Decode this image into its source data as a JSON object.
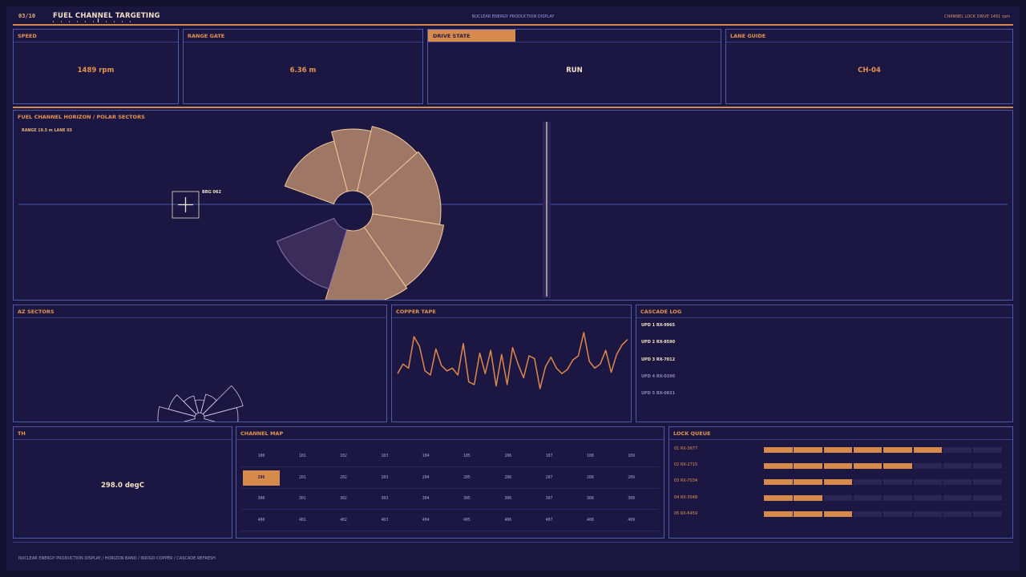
{
  "header": {
    "screen_index": "03/10",
    "title": "FUEL CHANNEL TARGETING",
    "system": "NUCLEAR ENERGY PRODUCTION DISPLAY",
    "status": "CHANNEL LOCK  DRIVE 1491 rpm"
  },
  "metrics": {
    "speed": {
      "label": "SPEED",
      "value": "1489 rpm"
    },
    "range_gate": {
      "label": "RANGE GATE",
      "value": "6.36 m"
    },
    "drive_state": {
      "label": "DRIVE STATE",
      "value": "RUN"
    },
    "lane_guide": {
      "label": "LANE GUIDE",
      "value": "CH-04"
    }
  },
  "horizon": {
    "title": "FUEL CHANNEL HORIZON  /  POLAR SECTORS",
    "subtitle": "RANGE 19.5 m  LANE 03",
    "bearing": "BRG 062"
  },
  "az_sectors": {
    "title": "AZ SECTORS"
  },
  "copper_tape": {
    "title": "COPPER TAPE",
    "values": [
      48,
      55,
      52,
      75,
      68,
      50,
      47,
      66,
      54,
      50,
      52,
      47,
      70,
      42,
      40,
      63,
      48,
      65,
      39,
      62,
      40,
      67,
      55,
      45,
      61,
      59,
      37,
      53,
      60,
      52,
      48,
      51,
      58,
      61,
      78,
      57,
      52,
      55,
      65,
      49,
      62,
      69,
      73
    ]
  },
  "cascade_log": {
    "title": "CASCADE LOG",
    "entries": [
      {
        "text": "UPD 1  RX-9965",
        "active": true
      },
      {
        "text": "UPD 2  RX-8590",
        "active": true
      },
      {
        "text": "UPD 3  RX-7012",
        "active": true
      },
      {
        "text": "UPD 4  RX-0390",
        "active": false
      },
      {
        "text": "UPD 5  RX-0831",
        "active": false
      }
    ]
  },
  "th": {
    "title": "TH",
    "value": "298.0 degC"
  },
  "channel_map": {
    "title": "CHANNEL MAP",
    "rows": [
      [
        "100",
        "101",
        "102",
        "103",
        "104",
        "105",
        "106",
        "107",
        "108",
        "109"
      ],
      [
        "200",
        "201",
        "202",
        "203",
        "204",
        "205",
        "206",
        "207",
        "208",
        "209"
      ],
      [
        "300",
        "301",
        "302",
        "303",
        "304",
        "305",
        "306",
        "307",
        "308",
        "309"
      ],
      [
        "400",
        "401",
        "402",
        "403",
        "404",
        "405",
        "406",
        "407",
        "408",
        "409"
      ]
    ],
    "selected": "200"
  },
  "lock_queue": {
    "title": "LOCK QUEUE",
    "items": [
      {
        "label": "01  RX-3677",
        "level": 6
      },
      {
        "label": "02  RX-2715",
        "level": 5
      },
      {
        "label": "03  RX-7034",
        "level": 3
      },
      {
        "label": "04  RX-3548",
        "level": 2
      },
      {
        "label": "05  RX-6459",
        "level": 3
      }
    ],
    "segments": 8
  },
  "footer": "NUCLEAR ENERGY PRODUCTION DISPLAY  /  HORIZON BAND  /  INDIGO COPPER  /  CASCADE REFRESH",
  "colors": {
    "copper": "#d68a4c",
    "indigo_bg": "#1b1640",
    "panel_border": "#4e58a8",
    "cream": "#f0e0c6",
    "violet_sector": "#3b2d5a"
  }
}
